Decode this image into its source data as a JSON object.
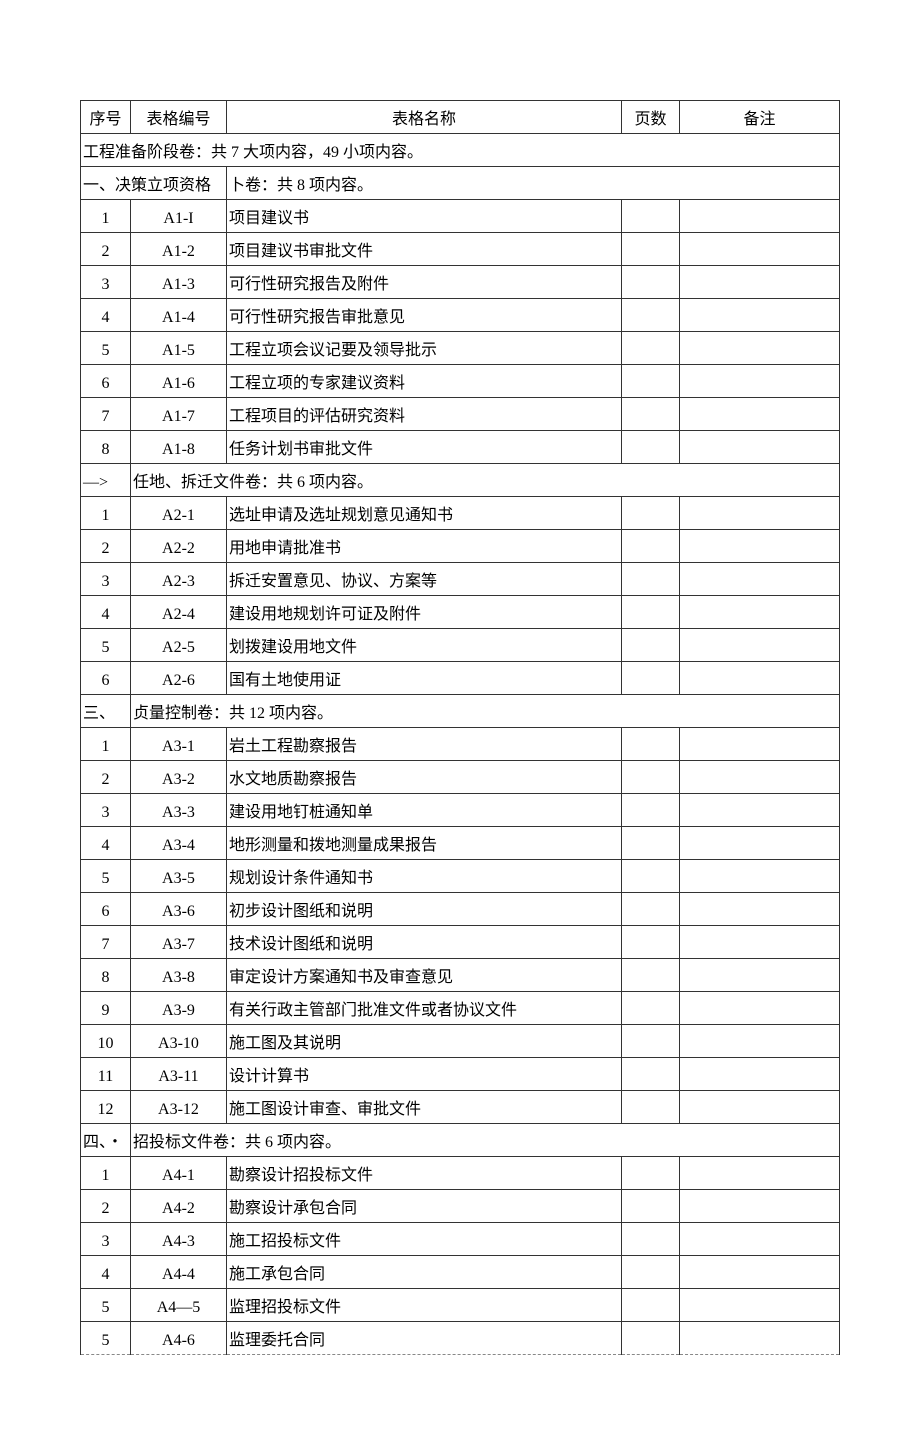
{
  "headers": {
    "seq": "序号",
    "code": "表格编号",
    "name": "表格名称",
    "page": "页数",
    "note": "备注"
  },
  "section0": "工程准备阶段卷：共 7 大项内容，49 小项内容。",
  "section1": {
    "left": "一、决策立项资格",
    "right": "卜卷：共 8 项内容。"
  },
  "rows1": [
    {
      "seq": "1",
      "code": "A1-I",
      "name": "项目建议书"
    },
    {
      "seq": "2",
      "code": "A1-2",
      "name": "项目建议书审批文件"
    },
    {
      "seq": "3",
      "code": "A1-3",
      "name": "可行性研究报告及附件"
    },
    {
      "seq": "4",
      "code": "A1-4",
      "name": "可行性研究报告审批意见"
    },
    {
      "seq": "5",
      "code": "A1-5",
      "name": "工程立项会议记要及领导批示"
    },
    {
      "seq": "6",
      "code": "A1-6",
      "name": "工程立项的专家建议资料"
    },
    {
      "seq": "7",
      "code": "A1-7",
      "name": "工程项目的评估研究资料"
    },
    {
      "seq": "8",
      "code": "A1-8",
      "name": "任务计划书审批文件"
    }
  ],
  "section2": {
    "left": "—>",
    "right": "任地、拆迁文件卷：共 6 项内容。"
  },
  "rows2": [
    {
      "seq": "1",
      "code": "A2-1",
      "name": "选址申请及选址规划意见通知书"
    },
    {
      "seq": "2",
      "code": "A2-2",
      "name": "用地申请批准书"
    },
    {
      "seq": "3",
      "code": "A2-3",
      "name": "拆迁安置意见、协议、方案等"
    },
    {
      "seq": "4",
      "code": "A2-4",
      "name": "建设用地规划许可证及附件"
    },
    {
      "seq": "5",
      "code": "A2-5",
      "name": "划拨建设用地文件"
    },
    {
      "seq": "6",
      "code": "A2-6",
      "name": "国有土地使用证"
    }
  ],
  "section3": {
    "left": "三、",
    "right": "贞量控制卷：共 12 项内容。"
  },
  "rows3": [
    {
      "seq": "1",
      "code": "A3-1",
      "name": "岩土工程勘察报告"
    },
    {
      "seq": "2",
      "code": "A3-2",
      "name": "水文地质勘察报告"
    },
    {
      "seq": "3",
      "code": "A3-3",
      "name": "建设用地钉桩通知单"
    },
    {
      "seq": "4",
      "code": "A3-4",
      "name": "地形测量和拨地测量成果报告"
    },
    {
      "seq": "5",
      "code": "A3-5",
      "name": "规划设计条件通知书"
    },
    {
      "seq": "6",
      "code": "A3-6",
      "name": "初步设计图纸和说明"
    },
    {
      "seq": "7",
      "code": "A3-7",
      "name": "技术设计图纸和说明"
    },
    {
      "seq": "8",
      "code": "A3-8",
      "name": "审定设计方案通知书及审查意见"
    },
    {
      "seq": "9",
      "code": "A3-9",
      "name": "有关行政主管部门批准文件或者协议文件"
    },
    {
      "seq": "10",
      "code": "A3-10",
      "name": "施工图及其说明"
    },
    {
      "seq": "11",
      "code": "A3-11",
      "name": "设计计算书"
    },
    {
      "seq": "12",
      "code": "A3-12",
      "name": "施工图设计审查、审批文件"
    }
  ],
  "section4": {
    "left": "四、・",
    "right": "招投标文件卷：共 6 项内容。"
  },
  "rows4": [
    {
      "seq": "1",
      "code": "A4-1",
      "name": "勘察设计招投标文件"
    },
    {
      "seq": "2",
      "code": "A4-2",
      "name": "勘察设计承包合同"
    },
    {
      "seq": "3",
      "code": "A4-3",
      "name": "施工招投标文件"
    },
    {
      "seq": "4",
      "code": "A4-4",
      "name": "施工承包合同"
    },
    {
      "seq": "5",
      "code": "A4—5",
      "name": "监理招投标文件"
    },
    {
      "seq": "5",
      "code": "A4-6",
      "name": "监理委托合同"
    }
  ]
}
